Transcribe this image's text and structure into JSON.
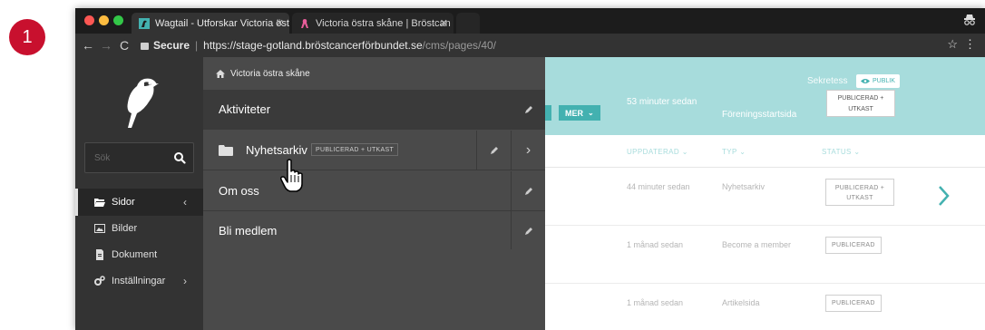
{
  "step_badge": "1",
  "browser": {
    "tabs": [
      {
        "label": "Wagtail - Utforskar Victoria öst",
        "active": true
      },
      {
        "label": "Victoria östra skåne | Bröstcan",
        "active": false
      }
    ],
    "url_secure_label": "Secure",
    "url_host": "https://stage-gotland.bröstcancerförbundet.se",
    "url_path": "/cms/pages/40/"
  },
  "sidebar": {
    "search_placeholder": "Sök",
    "items": [
      {
        "label": "Sidor",
        "active": true,
        "icon": "folder-open-icon"
      },
      {
        "label": "Bilder",
        "active": false,
        "icon": "image-icon"
      },
      {
        "label": "Dokument",
        "active": false,
        "icon": "document-icon"
      },
      {
        "label": "Inställningar",
        "active": false,
        "icon": "cogs-icon"
      }
    ]
  },
  "explorer": {
    "breadcrumb": "Victoria östra skåne",
    "rows": [
      {
        "title": "Aktiviteter"
      },
      {
        "title": "Nyhetsarkiv",
        "badge": "PUBLICERAD + UTKAST"
      },
      {
        "title": "Om oss"
      },
      {
        "title": "Bli medlem"
      }
    ]
  },
  "page_header": {
    "more_button": "MER",
    "updated": "53 minuter sedan",
    "type": "Föreningsstartsida",
    "privacy_label": "Sekretess",
    "public_badge": "PUBLIK",
    "status": "PUBLICERAD + UTKAST"
  },
  "listing": {
    "columns": {
      "updated": "UPPDATERAD",
      "type": "TYP",
      "status": "STATUS"
    },
    "rows": [
      {
        "updated": "44 minuter sedan",
        "type": "Nyhetsarkiv",
        "status": "PUBLICERAD + UTKAST"
      },
      {
        "updated": "1 månad sedan",
        "type": "Become a member",
        "status": "PUBLICERAD"
      },
      {
        "updated": "1 månad sedan",
        "type": "Artikelsida",
        "status": "PUBLICERAD"
      }
    ]
  },
  "colors": {
    "accent_teal": "#43b1b0",
    "header_teal": "#a7dcdc",
    "sidebar_dark": "#333333",
    "explorer_grey": "#4a4a4a",
    "step_badge_red": "#c8102e"
  }
}
